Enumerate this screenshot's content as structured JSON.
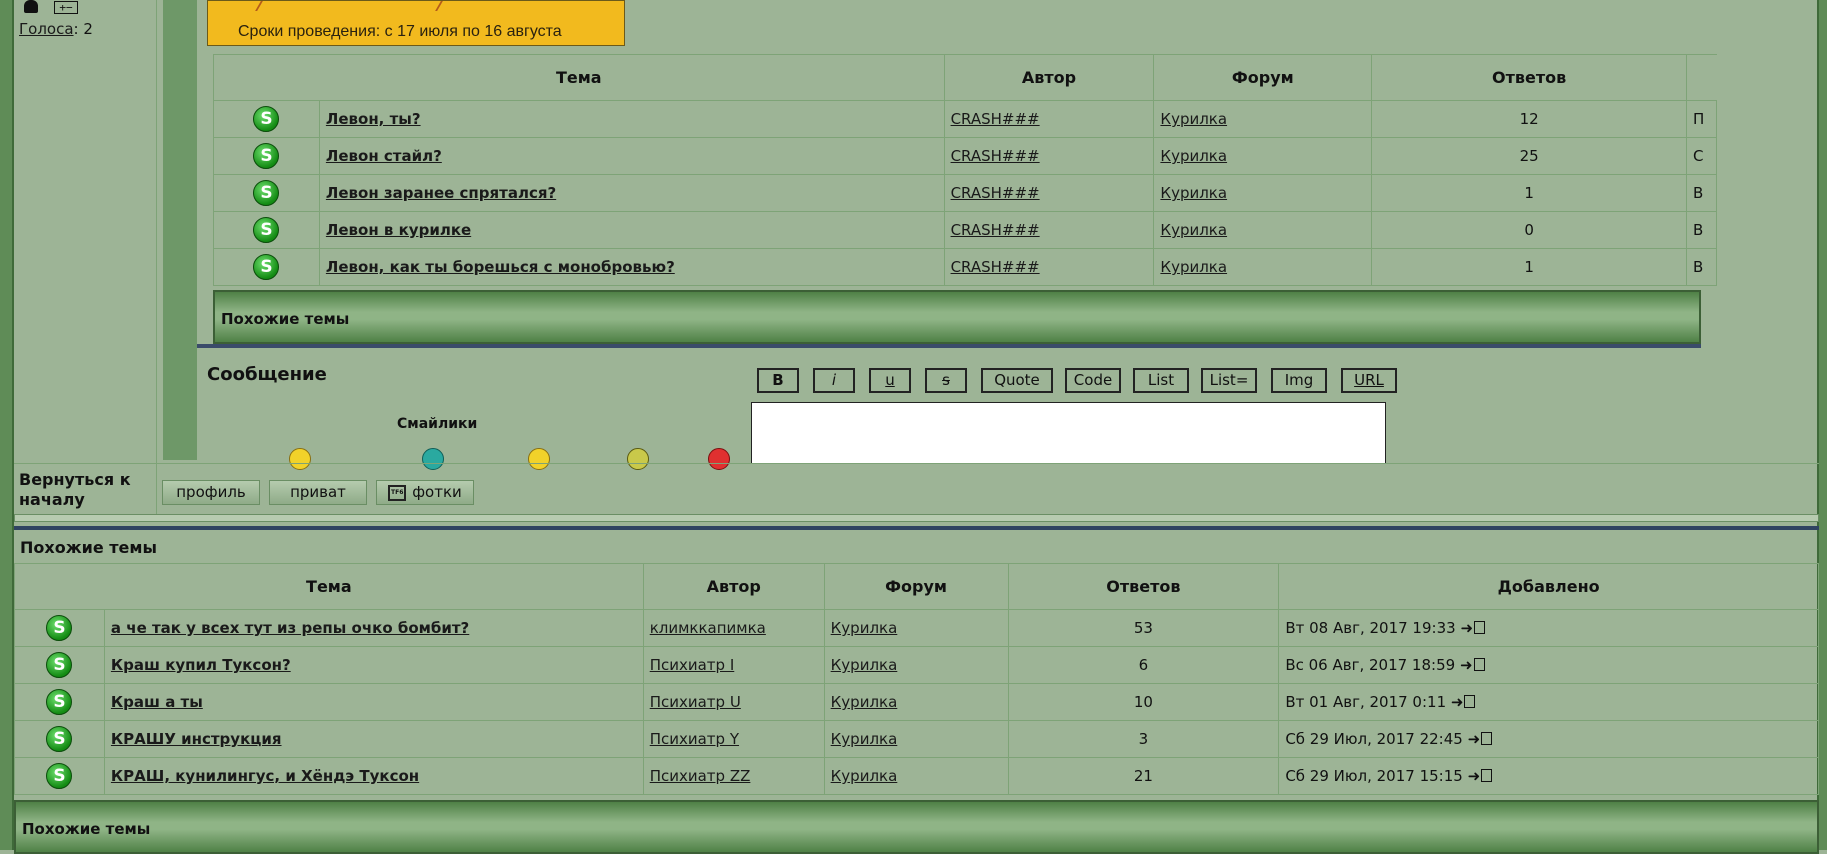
{
  "user": {
    "votes_label": "Голоса",
    "votes_sep": ":",
    "votes_count": "2"
  },
  "banner": {
    "text": "Сроки проведения: с 17 июля по 16 августа"
  },
  "upper_table": {
    "headers": [
      "Тема",
      "Автор",
      "Форум",
      "Ответов"
    ],
    "rows": [
      {
        "title": "Левон, ты?",
        "author": "CRASH###",
        "forum": "Курилка",
        "replies": "12",
        "added": "П"
      },
      {
        "title": "Левон стайл?",
        "author": "CRASH###",
        "forum": "Курилка",
        "replies": "25",
        "added": "С"
      },
      {
        "title": "Левон заранее спрятался?",
        "author": "CRASH###",
        "forum": "Курилка",
        "replies": "1",
        "added": "В"
      },
      {
        "title": "Левон в курилке",
        "author": "CRASH###",
        "forum": "Курилка",
        "replies": "0",
        "added": "В"
      },
      {
        "title": "Левон, как ты борешься с монобровью?",
        "author": "CRASH###",
        "forum": "Курилка",
        "replies": "1",
        "added": "В"
      }
    ],
    "footer_title": "Похожие темы"
  },
  "message": {
    "title": "Сообщение",
    "smilies_title": "Смайлики",
    "buttons": [
      "B",
      "i",
      "u",
      "s",
      "Quote",
      "Code",
      "List",
      "List=",
      "Img",
      "URL"
    ]
  },
  "back": {
    "label": "Вернуться к началу",
    "profile": "профиль",
    "private": "приват",
    "photos": "фотки",
    "camera_text": "TF6"
  },
  "lower_table": {
    "title": "Похожие темы",
    "headers": [
      "Тема",
      "Автор",
      "Форум",
      "Ответов",
      "Добавлено"
    ],
    "rows": [
      {
        "title": "а че так у всех тут из репы очко бомбит?",
        "author": "климккапимка",
        "forum": "Курилка",
        "replies": "53",
        "added": "Вт 08 Авг, 2017 19:33"
      },
      {
        "title": "Краш купил Туксон?",
        "author": "Психиатр I",
        "forum": "Курилка",
        "replies": "6",
        "added": "Вс 06 Авг, 2017 18:59"
      },
      {
        "title": "Краш а ты",
        "author": "Психиатр U",
        "forum": "Курилка",
        "replies": "10",
        "added": "Вт 01 Авг, 2017 0:11"
      },
      {
        "title": "КРАШУ инструкция",
        "author": "Психиатр Y",
        "forum": "Курилка",
        "replies": "3",
        "added": "Сб 29 Июл, 2017 22:45"
      },
      {
        "title": "КРАШ, кунилингус, и Хёндэ Туксон",
        "author": "Психиатр ZZ",
        "forum": "Курилка",
        "replies": "21",
        "added": "Сб 29 Июл, 2017 15:15"
      }
    ],
    "footer_title": "Похожие темы"
  },
  "icons": {
    "topic": "S",
    "goto": "➜"
  },
  "colors": {
    "background": "#9db496",
    "frame": "#5f8c57",
    "banner": "#f2ba1e",
    "separator": "#2f4361"
  }
}
